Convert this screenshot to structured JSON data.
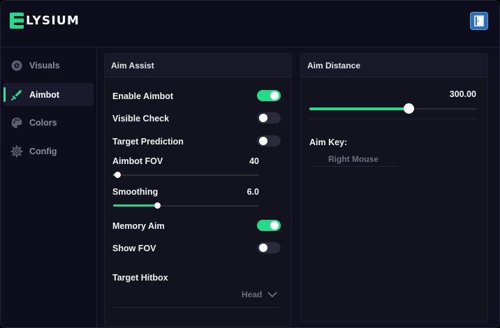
{
  "app": {
    "logo_letter": "E",
    "title": "LYSIUM"
  },
  "sidebar": {
    "items": [
      {
        "label": "Visuals",
        "icon": "eye-icon",
        "active": false
      },
      {
        "label": "Aimbot",
        "icon": "sword-icon",
        "active": true
      },
      {
        "label": "Colors",
        "icon": "palette-icon",
        "active": false
      },
      {
        "label": "Config",
        "icon": "gear-icon",
        "active": false
      }
    ]
  },
  "colors": {
    "accent": "#22dc8c",
    "background": "#0f0f1e",
    "panel": "#13131f",
    "exit_button": "#2a6fb8"
  },
  "aim_assist": {
    "title": "Aim Assist",
    "enable_aimbot": {
      "label": "Enable Aimbot",
      "on": true
    },
    "visible_check": {
      "label": "Visible Check",
      "on": false
    },
    "target_prediction": {
      "label": "Target Prediction",
      "on": false
    },
    "aimbot_fov": {
      "label": "Aimbot FOV",
      "value": "40",
      "fraction": 0.03
    },
    "smoothing": {
      "label": "Smoothing",
      "value": "6.0",
      "fraction": 0.3
    },
    "memory_aim": {
      "label": "Memory Aim",
      "on": true
    },
    "show_fov": {
      "label": "Show FOV",
      "on": false
    },
    "target_hitbox": {
      "label": "Target Hitbox",
      "selected": "Head"
    }
  },
  "aim_distance": {
    "title": "Aim Distance",
    "value": "300.00",
    "fraction": 0.59,
    "aim_key_label": "Aim Key:",
    "aim_key_value": "Right Mouse"
  }
}
